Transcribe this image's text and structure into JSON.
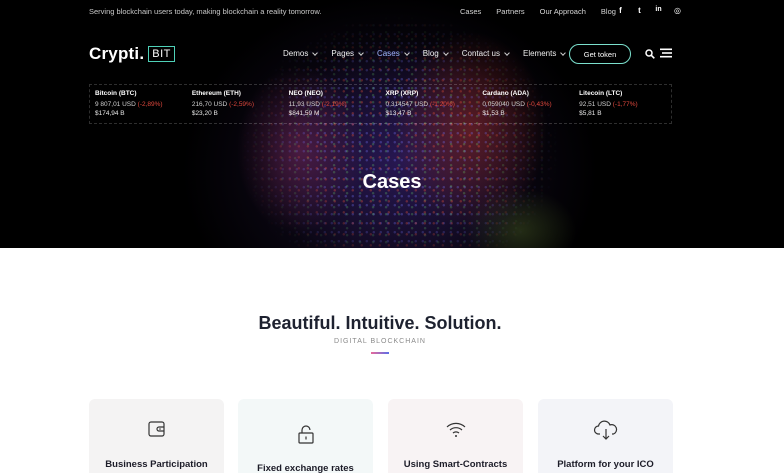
{
  "topbar": {
    "tagline": "Serving blockchain users today, making blockchain a reality tomorrow.",
    "links": [
      "Cases",
      "Partners",
      "Our Approach",
      "Blog"
    ],
    "social": [
      "facebook-icon",
      "twitter-icon",
      "linkedin-icon",
      "instagram-icon"
    ],
    "social_glyphs": [
      "f",
      "t",
      "in",
      "◎"
    ]
  },
  "logo": {
    "text": "Crypti.",
    "box": "BIT",
    "accent": "#4fd1b8"
  },
  "nav": {
    "items": [
      {
        "label": "Demos"
      },
      {
        "label": "Pages"
      },
      {
        "label": "Cases"
      },
      {
        "label": "Blog"
      },
      {
        "label": "Contact us"
      },
      {
        "label": "Elements"
      }
    ],
    "cta": "Get token"
  },
  "ticker": [
    {
      "name": "Bitcoin (BTC)",
      "price": "9 807,01 USD",
      "change": "(-2,89%)",
      "cap": "$174,94 B"
    },
    {
      "name": "Ethereum (ETH)",
      "price": "216,70 USD",
      "change": "(-2,59%)",
      "cap": "$23,20 B"
    },
    {
      "name": "NEO (NEO)",
      "price": "11,93 USD",
      "change": "(-2,19%)",
      "cap": "$841,59 M"
    },
    {
      "name": "XRP (XRP)",
      "price": "0,314547 USD",
      "change": "(-1,20%)",
      "cap": "$13,47 B"
    },
    {
      "name": "Cardano (ADA)",
      "price": "0,059040 USD",
      "change": "(-0,43%)",
      "cap": "$1,53 B"
    },
    {
      "name": "Litecoin (LTC)",
      "price": "92,51 USD",
      "change": "(-1,77%)",
      "cap": "$5,81 B"
    }
  ],
  "hero": {
    "title": "Cases"
  },
  "section": {
    "title": "Beautiful. Intuitive. Solution.",
    "subtitle": "DIGITAL BLOCKCHAIN"
  },
  "cards": [
    {
      "title": "Business Participation",
      "icon": "wallet-icon",
      "bg": "#f4f3f3"
    },
    {
      "title": "Fixed exchange rates",
      "icon": "unlock-icon",
      "bg": "#f3f8f8"
    },
    {
      "title": "Using Smart-Contracts",
      "icon": "wifi-icon",
      "bg": "#f8f3f4"
    },
    {
      "title": "Platform for your ICO",
      "icon": "cloud-download-icon",
      "bg": "#f3f4f8"
    }
  ]
}
